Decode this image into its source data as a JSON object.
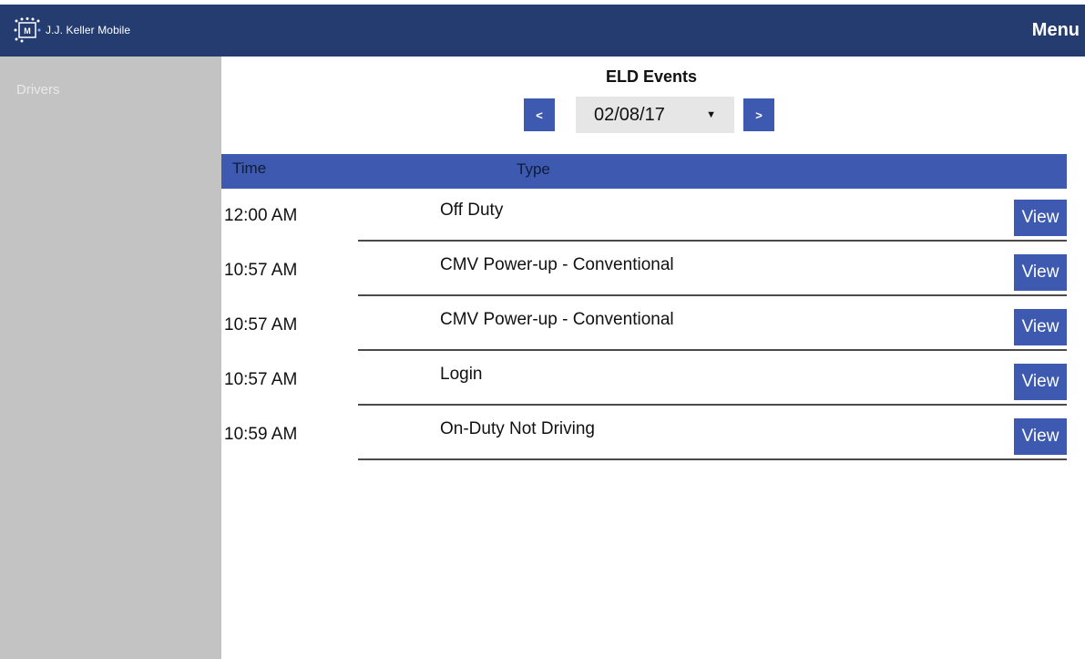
{
  "app": {
    "name": "J.J. Keller Mobile",
    "menu_label": "Menu"
  },
  "sidebar": {
    "items": [
      {
        "label": "Drivers"
      }
    ]
  },
  "page": {
    "title": "ELD Events",
    "prev_label": "<",
    "next_label": ">",
    "date_value": "02/08/17"
  },
  "table": {
    "columns": [
      "Time",
      "Type"
    ],
    "rows": [
      {
        "time": "12:00 AM",
        "type": "Off Duty",
        "action": "View"
      },
      {
        "time": "10:57 AM",
        "type": "CMV Power-up - Conventional",
        "action": "View"
      },
      {
        "time": "10:57 AM",
        "type": "CMV Power-up - Conventional",
        "action": "View"
      },
      {
        "time": "10:57 AM",
        "type": "Login",
        "action": "View"
      },
      {
        "time": "10:59 AM",
        "type": "On-Duty Not Driving",
        "action": "View"
      }
    ]
  },
  "icons": {
    "logo": "jj-keller-logo-icon",
    "dropdown": "caret-down-icon"
  },
  "colors": {
    "topbar": "#243c70",
    "accent": "#3d5ab0",
    "sidebar": "#c3c3c3"
  }
}
